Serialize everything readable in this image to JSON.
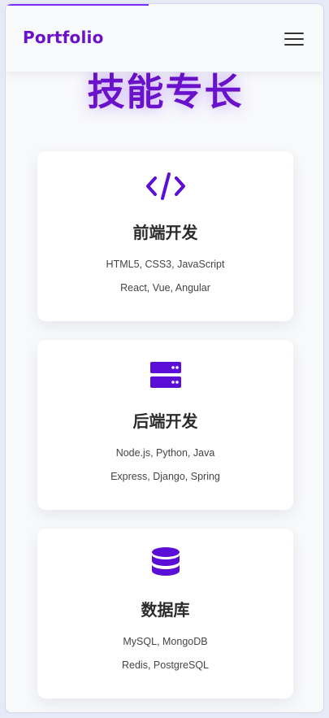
{
  "header": {
    "brand": "Portfolio",
    "menu_icon": "hamburger-menu-icon"
  },
  "page": {
    "scroll_progress": 0.45
  },
  "skills": {
    "title": "技能专长",
    "cards": [
      {
        "icon": "code-icon",
        "title": "前端开发",
        "line1": "HTML5, CSS3, JavaScript",
        "line2": "React, Vue, Angular"
      },
      {
        "icon": "server-icon",
        "title": "后端开发",
        "line1": "Node.js, Python, Java",
        "line2": "Express, Django, Spring"
      },
      {
        "icon": "database-icon",
        "title": "数据库",
        "line1": "MySQL, MongoDB",
        "line2": "Redis, PostgreSQL"
      }
    ]
  },
  "colors": {
    "accent": "#6a11cb",
    "icon": "#5b0fd6",
    "text_dark": "#2b2b2b"
  }
}
